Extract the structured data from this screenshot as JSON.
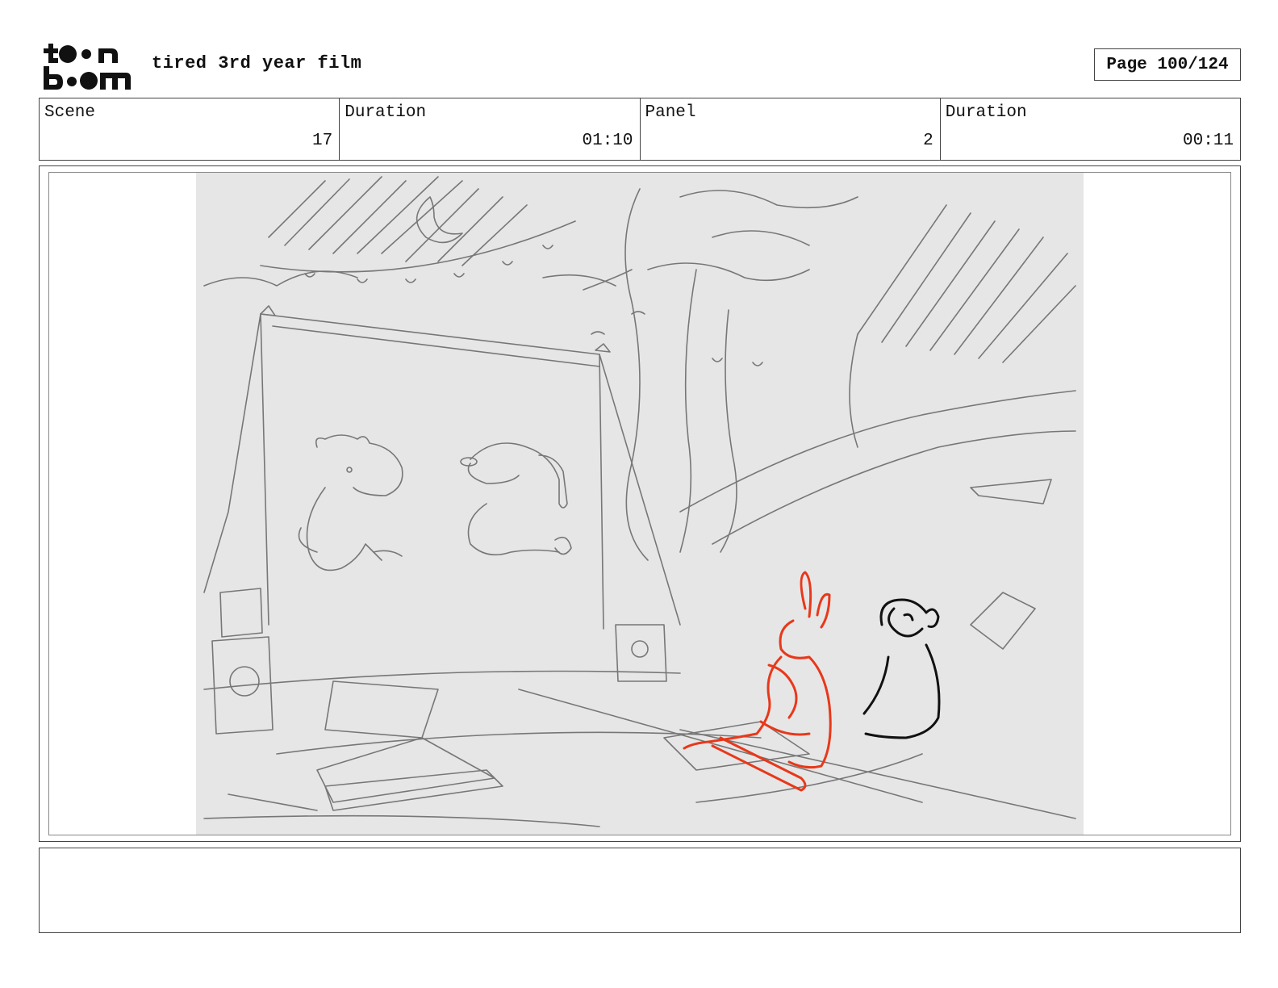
{
  "header": {
    "logo_text_top": "toon",
    "logo_text_bottom": "boom",
    "project_title": "tired 3rd year film",
    "page_indicator": "Page 100/124"
  },
  "info_bar": {
    "scene_label": "Scene",
    "scene_value": "17",
    "scene_duration_label": "Duration",
    "scene_duration_value": "01:10",
    "panel_label": "Panel",
    "panel_value": "2",
    "panel_duration_label": "Duration",
    "panel_duration_value": "00:11"
  },
  "panel": {
    "sketch_bg": "#e6e6e6",
    "pencil_color": "#777777",
    "rabbit_color": "#e8381a",
    "monkey_color": "#111111"
  },
  "notes": {
    "text": ""
  }
}
